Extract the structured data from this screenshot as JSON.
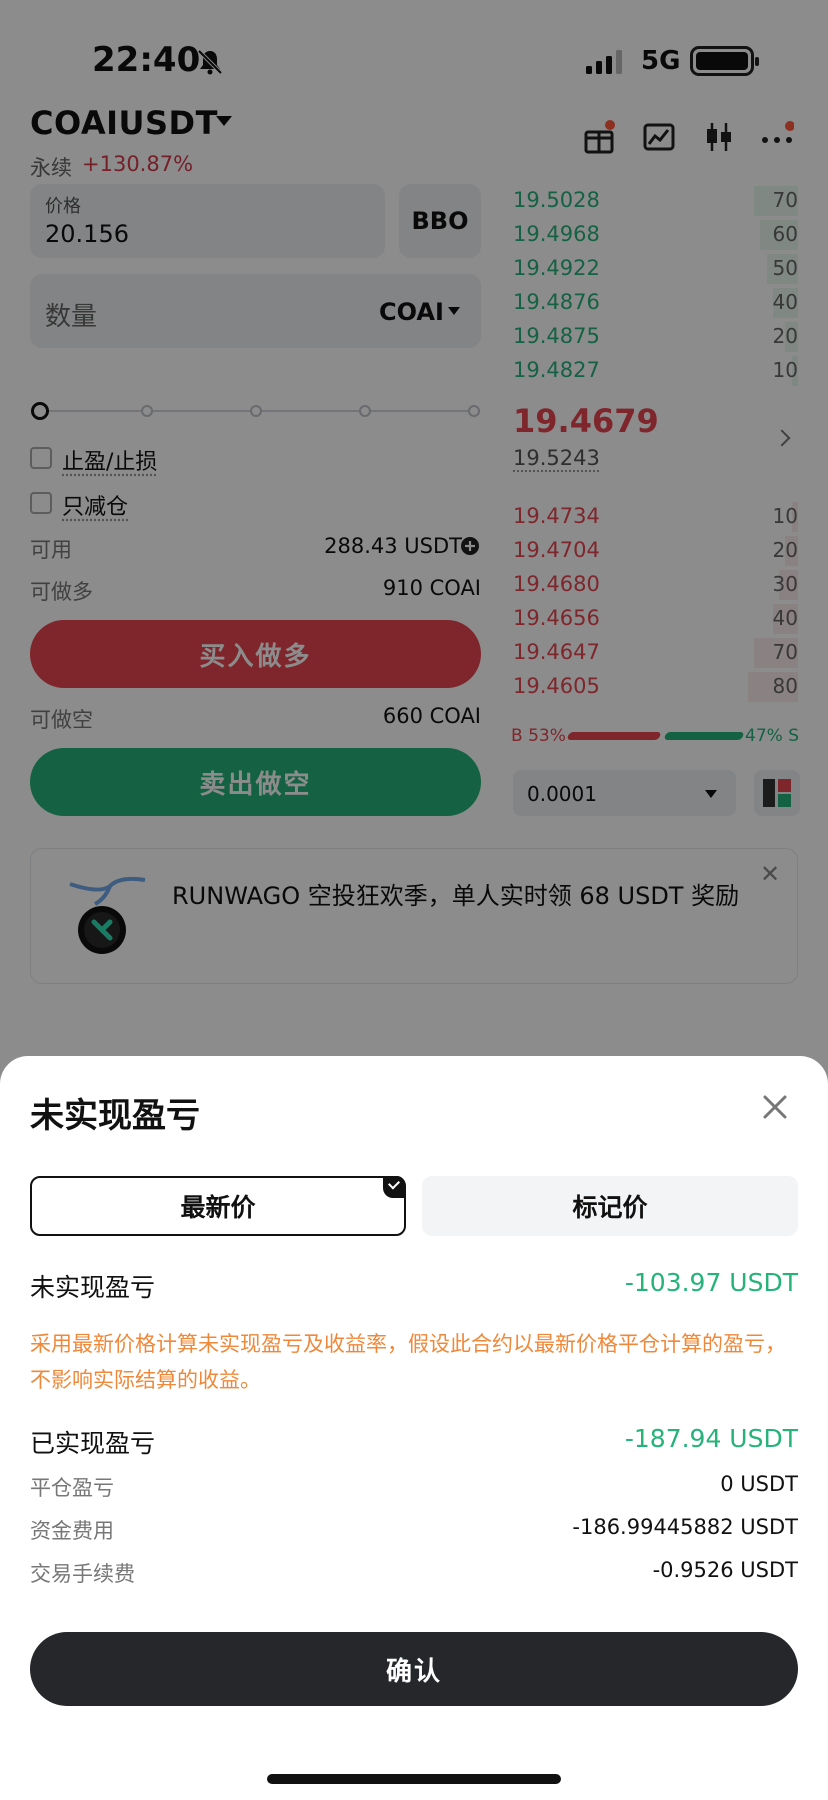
{
  "status_bar": {
    "time": "22:40",
    "network": "5G"
  },
  "header": {
    "pair": "COAIUSDT",
    "contract_type": "永续",
    "change": "+130.87%"
  },
  "order_form": {
    "price_label": "价格",
    "price_value": "20.156",
    "bbo_label": "BBO",
    "quantity_placeholder": "数量",
    "quantity_unit": "COAI",
    "tp_sl_label": "止盈/止损",
    "reduce_only_label": "只减仓",
    "available_label": "可用",
    "available_value": "288.43 USDT",
    "max_long_label": "可做多",
    "max_long_value": "910 COAI",
    "buy_button": "买入做多",
    "max_short_label": "可做空",
    "max_short_value": "660 COAI",
    "sell_button": "卖出做空"
  },
  "order_book": {
    "asks": [
      {
        "price": "19.5028",
        "qty": "70"
      },
      {
        "price": "19.4968",
        "qty": "60"
      },
      {
        "price": "19.4922",
        "qty": "50"
      },
      {
        "price": "19.4876",
        "qty": "40"
      },
      {
        "price": "19.4875",
        "qty": "20"
      },
      {
        "price": "19.4827",
        "qty": "10"
      }
    ],
    "last_price": "19.4679",
    "mark_price": "19.5243",
    "bids": [
      {
        "price": "19.4734",
        "qty": "10"
      },
      {
        "price": "19.4704",
        "qty": "20"
      },
      {
        "price": "19.4680",
        "qty": "30"
      },
      {
        "price": "19.4656",
        "qty": "40"
      },
      {
        "price": "19.4647",
        "qty": "70"
      },
      {
        "price": "19.4605",
        "qty": "80"
      }
    ],
    "buy_ratio": "B 53%",
    "sell_ratio": "47% S",
    "precision": "0.0001"
  },
  "banner": {
    "text": "RUNWAGO 空投狂欢季，单人实时领 68 USDT 奖励"
  },
  "sheet": {
    "title": "未实现盈亏",
    "tab_latest": "最新价",
    "tab_mark": "标记价",
    "unrealized_label": "未实现盈亏",
    "unrealized_value": "-103.97 USDT",
    "note": "采用最新价格计算未实现盈亏及收益率，假设此合约以最新价格平仓计算的盈亏，不影响实际结算的收益。",
    "realized_label": "已实现盈亏",
    "realized_value": "-187.94 USDT",
    "close_pnl_label": "平仓盈亏",
    "close_pnl_value": "0 USDT",
    "funding_label": "资金费用",
    "funding_value": "-186.99445882 USDT",
    "fee_label": "交易手续费",
    "fee_value": "-0.9526 USDT",
    "confirm": "确认"
  },
  "colors": {
    "up": "#26b37a",
    "down": "#e64551",
    "note": "#f0883a"
  }
}
